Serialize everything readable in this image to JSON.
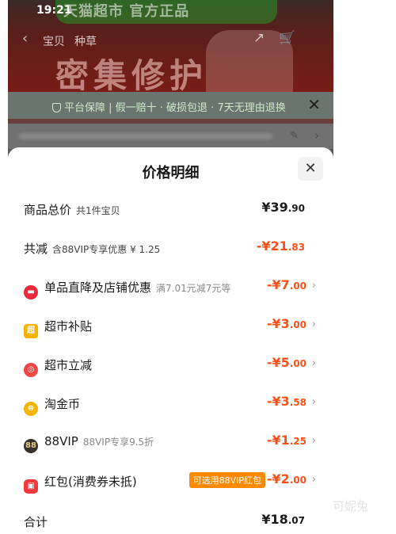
{
  "status": {
    "time": "19:21"
  },
  "background": {
    "promo_text": "天猫超市 官方正品",
    "nav_tabs": [
      "宝贝",
      "种草"
    ],
    "hero_text": "密集修护",
    "guarantee_text": "平台保障 | 假一赔十 · 破损包退 · 7天无理由退换"
  },
  "sheet": {
    "title": "价格明细",
    "total": {
      "label": "商品总价",
      "sub": "共1件宝贝",
      "yen": "¥",
      "int": "39",
      "dec": ".90"
    },
    "reduced": {
      "label": "共减",
      "sub": "含88VIP专享优惠 ¥ 1.25",
      "yen": "-¥",
      "int": "21",
      "dec": ".83"
    },
    "items": [
      {
        "label": "单品直降及店铺优惠",
        "sub": "满7.01元减7元等",
        "yen": "-¥",
        "int": "7",
        "dec": ".00",
        "icon": "discount-coupon-icon",
        "color": "#e8293a"
      },
      {
        "label": "超市补贴",
        "sub": "",
        "yen": "-¥",
        "int": "3",
        "dec": ".00",
        "icon": "supermarket-icon",
        "color": "#f6b300"
      },
      {
        "label": "超市立减",
        "sub": "",
        "yen": "-¥",
        "int": "5",
        "dec": ".00",
        "icon": "instant-discount-icon",
        "color": "#f04646"
      },
      {
        "label": "淘金币",
        "sub": "",
        "yen": "-¥",
        "int": "3",
        "dec": ".58",
        "icon": "gold-coin-icon",
        "color": "#f5b400"
      },
      {
        "label": "88VIP",
        "sub": "88VIP专享9.5折",
        "yen": "-¥",
        "int": "1",
        "dec": ".25",
        "icon": "vip-88-icon",
        "color": "#3a322a"
      },
      {
        "label": "红包(消费券未抵)",
        "sub": "",
        "yen": "-¥",
        "int": "2",
        "dec": ".00",
        "icon": "red-packet-icon",
        "color": "#f0383a",
        "tag": "可选用88VIP红包"
      }
    ],
    "sum": {
      "label": "合计",
      "yen": "¥",
      "int": "18",
      "dec": ".07"
    }
  },
  "watermark": "可妮兔",
  "colors": {
    "accent_red": "#ff4f16",
    "tag_orange": "#ff8a00"
  }
}
